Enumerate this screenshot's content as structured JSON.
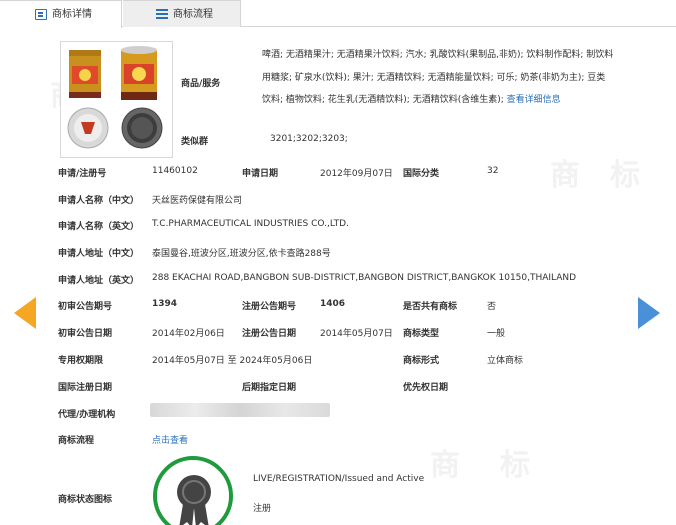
{
  "tabs": [
    {
      "label": "商标详情",
      "active": true
    },
    {
      "label": "商标流程",
      "active": false
    }
  ],
  "goods": {
    "label": "商品/服务",
    "text": "啤酒; 无酒精果汁; 无酒精果汁饮料; 汽水; 乳酸饮料(果制品,非奶); 饮料制作配料; 制饮料用糖浆; 矿泉水(饮料); 果汁; 无酒精饮料; 无酒精能量饮料; 可乐; 奶茶(非奶为主); 豆类饮料; 植物饮料; 花生乳(无酒精饮料); 无酒精饮料(含维生素);",
    "link": "查看详细信息"
  },
  "similar_group": {
    "label": "类似群",
    "value": "3201;3202;3203;"
  },
  "fields": {
    "reg_no": {
      "label": "申请/注册号",
      "value": "11460102"
    },
    "apply_date": {
      "label": "申请日期",
      "value": "2012年09月07日"
    },
    "intl_class": {
      "label": "国际分类",
      "value": "32"
    },
    "applicant_cn": {
      "label": "申请人名称（中文）",
      "value": "天丝医药保健有限公司"
    },
    "applicant_en": {
      "label": "申请人名称（英文）",
      "value": "T.C.PHARMACEUTICAL INDUSTRIES CO.,LTD."
    },
    "address_cn": {
      "label": "申请人地址（中文）",
      "value": "泰国曼谷,班波分区,班波分区,依卡查路288号"
    },
    "address_en": {
      "label": "申请人地址（英文）",
      "value": "288 EKACHAI ROAD,BANGBON SUB-DISTRICT,BANGBON DISTRICT,BANGKOK 10150,THAILAND"
    },
    "prelim_no": {
      "label": "初审公告期号",
      "value": "1394"
    },
    "reg_pub_no": {
      "label": "注册公告期号",
      "value": "1406"
    },
    "shared": {
      "label": "是否共有商标",
      "value": "否"
    },
    "prelim_date": {
      "label": "初审公告日期",
      "value": "2014年02月06日"
    },
    "reg_pub_date": {
      "label": "注册公告日期",
      "value": "2014年05月07日"
    },
    "mark_type": {
      "label": "商标类型",
      "value": "一般"
    },
    "exclusive_period": {
      "label": "专用权期限",
      "value": "2014年05月07日 至 2024年05月06日"
    },
    "mark_form": {
      "label": "商标形式",
      "value": "立体商标"
    },
    "intl_reg_date": {
      "label": "国际注册日期",
      "value": ""
    },
    "late_spec_date": {
      "label": "后期指定日期",
      "value": ""
    },
    "priority_date": {
      "label": "优先权日期",
      "value": ""
    },
    "agent": {
      "label": "代理/办理机构",
      "value": ""
    },
    "flow": {
      "label": "商标流程",
      "value": "点击查看"
    },
    "status": {
      "label": "商标状态图标",
      "value_en": "LIVE/REGISTRATION/Issued and Active",
      "value_cn": "注册"
    }
  },
  "colors": {
    "link": "#2b6fb6",
    "seal": "#1f9a3c",
    "arrow_left": "#f5a623",
    "arrow_right": "#4a90d9"
  }
}
